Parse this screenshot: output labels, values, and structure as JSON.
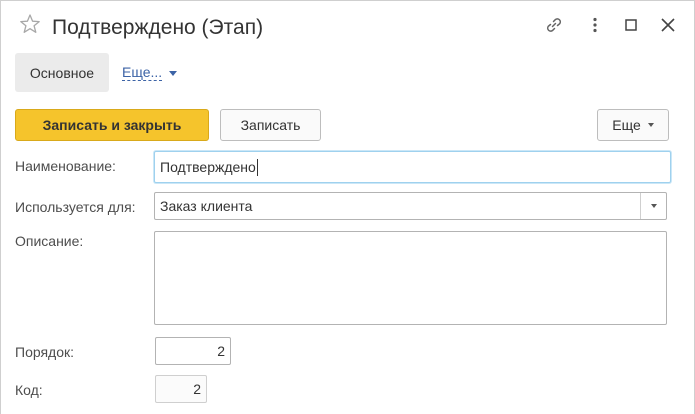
{
  "window": {
    "title": "Подтверждено (Этап)",
    "icons": [
      "star-icon",
      "link-icon",
      "more-vertical-icon",
      "maximize-icon",
      "close-icon"
    ]
  },
  "tabs": {
    "main": "Основное",
    "more": "Еще..."
  },
  "toolbar": {
    "save_close": "Записать и закрыть",
    "save": "Записать",
    "more": "Еще"
  },
  "form": {
    "name_label": "Наименование:",
    "name_value": "Подтверждено",
    "used_for_label": "Используется для:",
    "used_for_value": "Заказ клиента",
    "description_label": "Описание:",
    "description_value": "",
    "order_label": "Порядок:",
    "order_value": "2",
    "code_label": "Код:",
    "code_value": "2"
  },
  "colors": {
    "primary_button": "#f5c42c",
    "link": "#3c63a6",
    "focus_border": "#9fd1ee"
  }
}
